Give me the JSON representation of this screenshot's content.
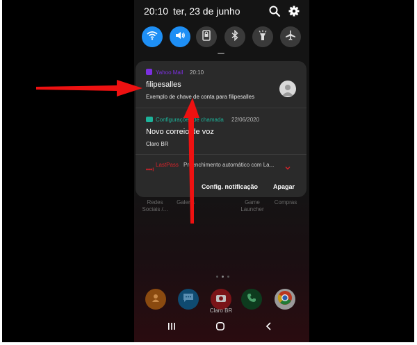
{
  "status_bar": {
    "time": "20:10",
    "date": "ter, 23 de junho"
  },
  "quick_settings": [
    {
      "name": "wifi",
      "icon": "wifi-icon",
      "active": true
    },
    {
      "name": "sound",
      "icon": "volume-icon",
      "active": true
    },
    {
      "name": "rotation",
      "icon": "rotation-lock-icon",
      "active": false
    },
    {
      "name": "bluetooth",
      "icon": "bluetooth-icon",
      "active": false
    },
    {
      "name": "flashlight",
      "icon": "flashlight-icon",
      "active": false
    },
    {
      "name": "airplane",
      "icon": "airplane-icon",
      "active": false
    }
  ],
  "notifications": [
    {
      "app": "Yahoo Mail",
      "app_color": "#7b2fe0",
      "time": "20:10",
      "title": "filipesalles",
      "body": "Exemplo de chave de conta para filipesalles"
    },
    {
      "app": "Configurações de chamada",
      "app_color": "#1db39a",
      "time": "22/06/2020",
      "title": "Novo correio de voz",
      "body": "Claro BR"
    },
    {
      "app": "LastPass",
      "app_color": "#d8232a",
      "body": "Preenchimento automático com La..."
    }
  ],
  "actions": {
    "settings": "Config. notificação",
    "clear": "Apagar"
  },
  "home": {
    "apps": [
      {
        "label": "Redes Sociais /..."
      },
      {
        "label": "Galeria"
      },
      {
        "label": "Game Launcher"
      },
      {
        "label": "Compras"
      }
    ],
    "dock_camera_label": "Claro BR"
  },
  "colors": {
    "accent": "#1e8ff5",
    "arrow": "#ee1111"
  }
}
